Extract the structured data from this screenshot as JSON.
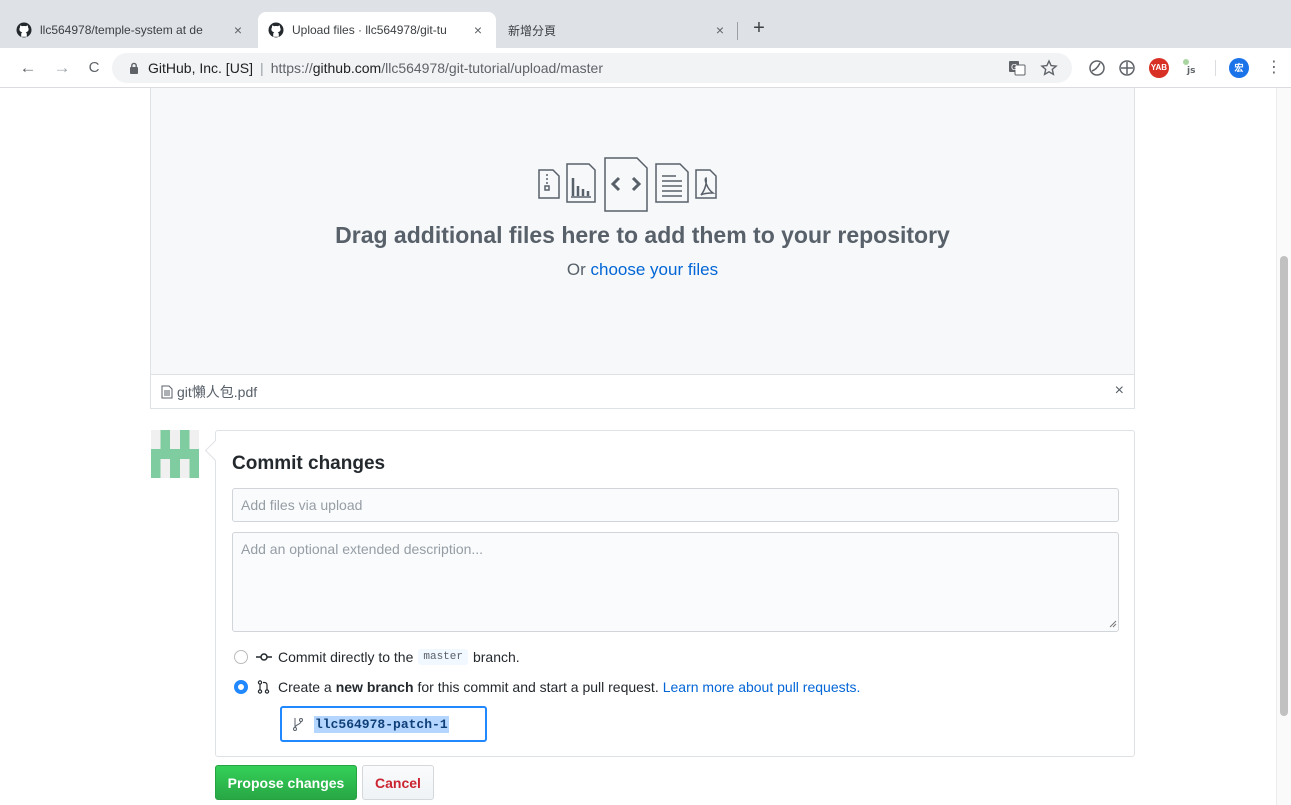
{
  "browser": {
    "tabs": [
      {
        "title": "llc564978/temple-system at de",
        "active": false
      },
      {
        "title": "Upload files · llc564978/git-tu",
        "active": true
      },
      {
        "title": "新增分頁",
        "active": false
      }
    ],
    "tab_close_glyph": "×",
    "new_tab_glyph": "+",
    "nav": {
      "back": "←",
      "forward": "→",
      "reload": "C"
    },
    "address": {
      "org": "GitHub, Inc. [US]",
      "separator": "|",
      "scheme": "https://",
      "host": "github.com",
      "path": "/llc564978/git-tutorial/upload/master"
    },
    "extensions": [
      "translate-icon",
      "star-icon",
      "extension-icon",
      "extension-icon",
      "yab-extension",
      "js-extension",
      "profile-avatar"
    ],
    "profile_initial": "宏",
    "menu_glyph": "⋮"
  },
  "upload": {
    "drop_title": "Drag additional files here to add them to your repository",
    "or_text": "Or",
    "choose_link": "choose your files",
    "file_name": "git懶人包.pdf",
    "remove_glyph": "×"
  },
  "commit": {
    "title": "Commit changes",
    "summary_placeholder": "Add files via upload",
    "description_placeholder": "Add an optional extended description...",
    "option_direct": {
      "prefix": "Commit directly to the",
      "branch": "master",
      "suffix": "branch.",
      "selected": false
    },
    "option_new": {
      "prefix": "Create a",
      "bold": "new branch",
      "suffix": "for this commit and start a pull request.",
      "link": "Learn more about pull requests.",
      "selected": true
    },
    "branch_name": "llc564978-patch-1"
  },
  "actions": {
    "propose": "Propose changes",
    "cancel": "Cancel"
  },
  "colors": {
    "accent": "#0366d6",
    "primary_button": "#28a745",
    "cancel_text": "#cb2431",
    "focus": "#2188ff"
  }
}
